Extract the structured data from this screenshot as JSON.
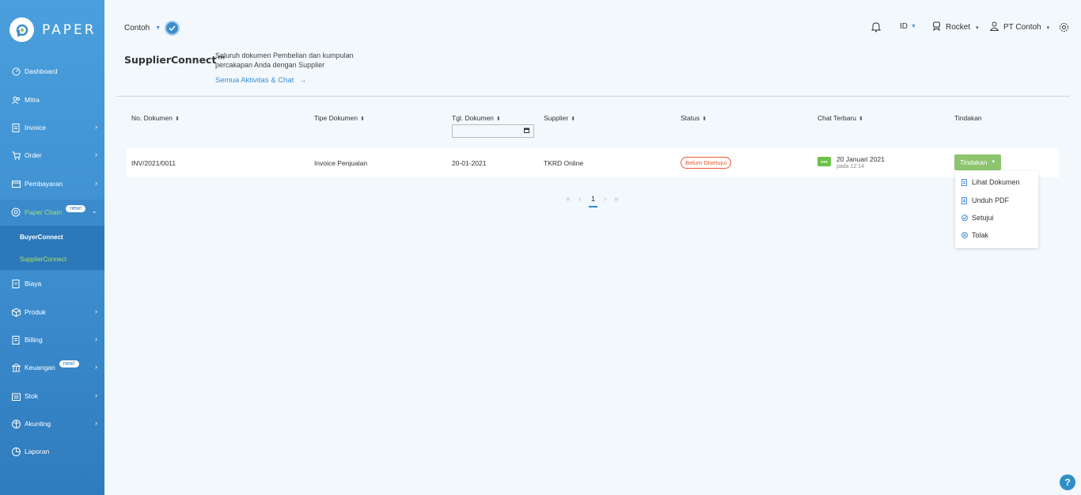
{
  "sidebar": {
    "logo_text": "PAPER",
    "items": [
      {
        "label": "Dashboard"
      },
      {
        "label": "Mitra"
      },
      {
        "label": "Invoice"
      },
      {
        "label": "Order"
      },
      {
        "label": "Pembayaran"
      },
      {
        "label": "Paper Chain",
        "badge": "new!"
      },
      {
        "label": "Biaya"
      },
      {
        "label": "Produk"
      },
      {
        "label": "Billing"
      },
      {
        "label": "Keuangan",
        "badge": "new!"
      },
      {
        "label": "Stok"
      },
      {
        "label": "Akunting"
      },
      {
        "label": "Laporan"
      }
    ],
    "subitems": [
      {
        "label": "BuyerConnect"
      },
      {
        "label": "SupplierConnect"
      }
    ]
  },
  "topbar": {
    "company": "Contoh",
    "language": "ID",
    "plan": "Rocket",
    "account": "PT Contoh"
  },
  "page": {
    "title": "SupplierConnect™",
    "description": "Seluruh dokumen Pembelian dan kumpulan percakapan Anda dengan Supplier",
    "link": "Semua Aktivitas & Chat",
    "link_arrow": "→"
  },
  "table": {
    "headers": [
      "No. Dokumen",
      "Tipe Dokumen",
      "Tgl. Dokumen",
      "Supplier",
      "Status",
      "Chat Terbaru",
      "Tindakan"
    ],
    "rows": [
      {
        "no_dokumen": "INV/2021/0011",
        "tipe": "Invoice Penjualan",
        "tanggal": "20-01-2021",
        "supplier": "TKRD Online",
        "status": "Belum Disetujui",
        "chat_date": "20 Januari 2021",
        "chat_time": "pada 12:14",
        "action_label": "Tindakan"
      }
    ]
  },
  "dropdown": {
    "items": [
      {
        "label": "Lihat Dokumen"
      },
      {
        "label": "Unduh PDF"
      },
      {
        "label": "Setujui"
      },
      {
        "label": "Tolak"
      }
    ]
  },
  "pagination": {
    "current": "1"
  },
  "help": "?",
  "colors": {
    "accent": "#3d8ecf",
    "green": "#8cc56d",
    "status": "#e8592c"
  }
}
